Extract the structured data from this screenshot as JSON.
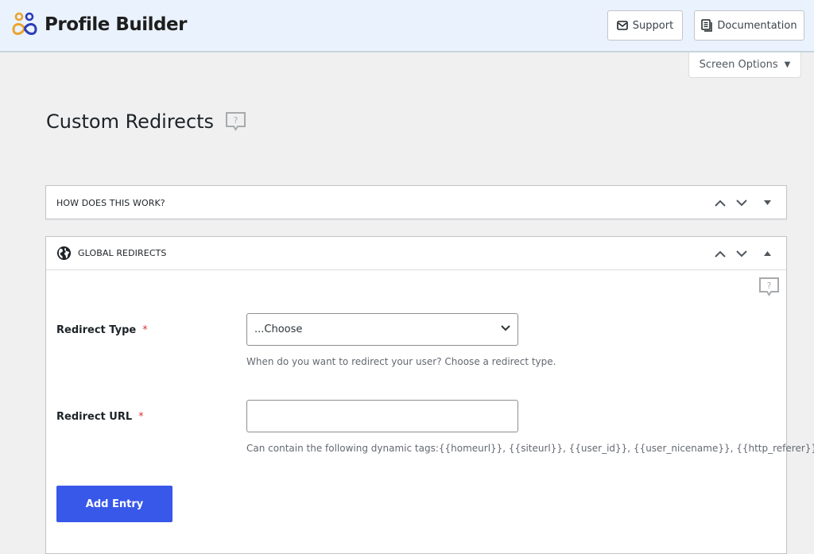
{
  "header": {
    "brand_name": "Profile Builder",
    "support_label": "Support",
    "documentation_label": "Documentation",
    "screen_options_label": "Screen Options"
  },
  "page": {
    "title": "Custom Redirects"
  },
  "boxes": {
    "how_it_works": {
      "title": "HOW DOES THIS WORK?",
      "state": "collapsed"
    },
    "global_redirects": {
      "title": "GLOBAL REDIRECTS",
      "state": "expanded",
      "fields": {
        "redirect_type": {
          "label": "Redirect Type",
          "required_mark": "*",
          "selected": "...Choose",
          "description": "When do you want to redirect your user? Choose a redirect type."
        },
        "redirect_url": {
          "label": "Redirect URL",
          "required_mark": "*",
          "value": "",
          "placeholder": "",
          "description": "Can contain the following dynamic tags:{{homeurl}}, {{siteurl}}, {{user_id}}, {{user_nicename}}, {{http_referer}}"
        }
      },
      "add_button_label": "Add Entry"
    }
  },
  "colors": {
    "accent": "#3858e9",
    "header_bg": "#eaf2fd",
    "required": "#d63638",
    "logo_orange": "#e8a42c",
    "logo_blue": "#2b3db8"
  }
}
